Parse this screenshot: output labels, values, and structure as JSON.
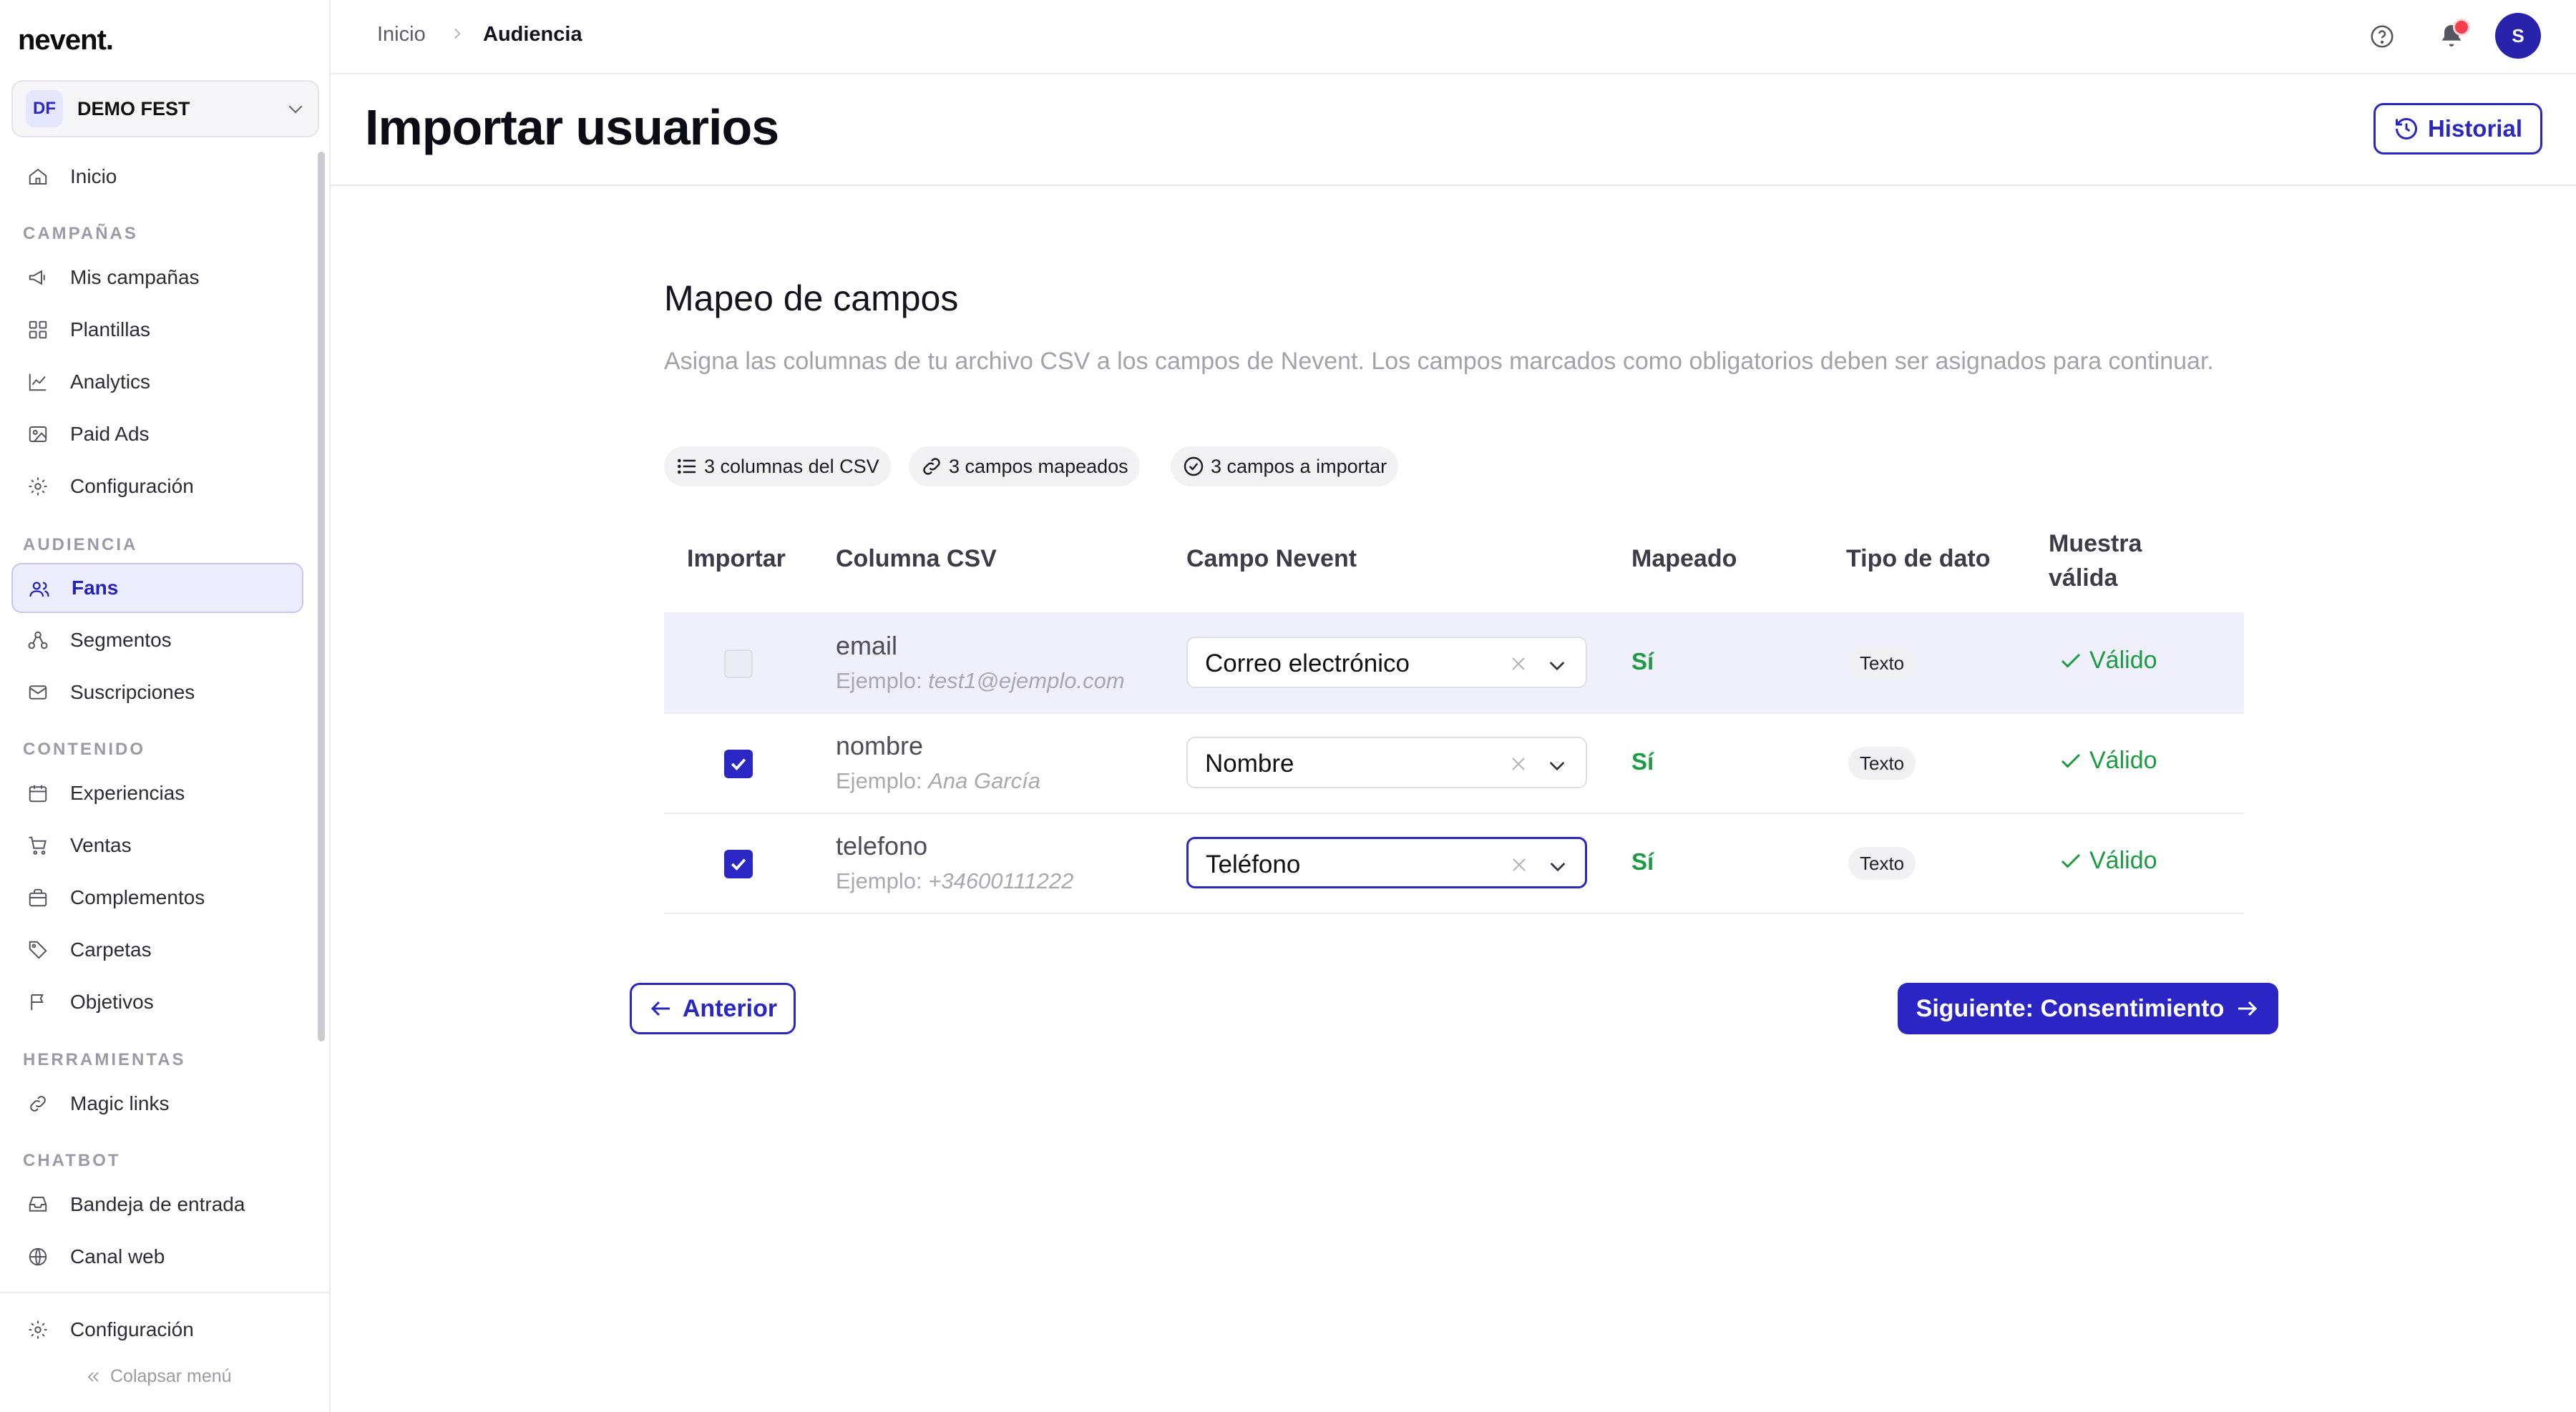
{
  "app": {
    "logo": "nevent."
  },
  "org": {
    "initials": "DF",
    "name": "DEMO FEST"
  },
  "sidebar": {
    "home": "Inicio",
    "campaigns_title": "CAMPAÑAS",
    "campaigns": [
      "Mis campañas",
      "Plantillas",
      "Analytics",
      "Paid Ads",
      "Configuración"
    ],
    "audience_title": "AUDIENCIA",
    "audience": [
      "Fans",
      "Segmentos",
      "Suscripciones"
    ],
    "content_title": "CONTENIDO",
    "content": [
      "Experiencias",
      "Ventas",
      "Complementos",
      "Carpetas",
      "Objetivos"
    ],
    "tools_title": "HERRAMIENTAS",
    "tools": [
      "Magic links"
    ],
    "chatbot_title": "CHATBOT",
    "chatbot": [
      "Bandeja de entrada",
      "Canal web"
    ],
    "settings": "Configuración",
    "collapse": "Colapsar menú"
  },
  "breadcrumb": {
    "root": "Inicio",
    "current": "Audiencia"
  },
  "user": {
    "initial": "S"
  },
  "page": {
    "title": "Importar usuarios",
    "history_button": "Historial"
  },
  "mapping": {
    "title": "Mapeo de campos",
    "description": "Asigna las columnas de tu archivo CSV a los campos de Nevent. Los campos marcados como obligatorios deben ser asignados para continuar.",
    "chips": [
      "3 columnas del CSV",
      "3 campos mapeados",
      "3 campos a importar"
    ],
    "headers": {
      "import": "Importar",
      "csv_column": "Columna CSV",
      "nevent_field": "Campo Nevent",
      "mapped": "Mapeado",
      "data_type": "Tipo de dato",
      "sample": "Muestra válida"
    },
    "rows": [
      {
        "column": "email",
        "example_prefix": "Ejemplo:",
        "example": "test1@ejemplo.com",
        "field": "Correo electrónico",
        "mapped": "Sí",
        "type": "Texto",
        "valid": "Válido",
        "checked": true,
        "disabled": true
      },
      {
        "column": "nombre",
        "example_prefix": "Ejemplo:",
        "example": "Ana García",
        "field": "Nombre",
        "mapped": "Sí",
        "type": "Texto",
        "valid": "Válido",
        "checked": true,
        "disabled": false
      },
      {
        "column": "telefono",
        "example_prefix": "Ejemplo:",
        "example": "+34600111222",
        "field": "Teléfono",
        "mapped": "Sí",
        "type": "Texto",
        "valid": "Válido",
        "checked": true,
        "disabled": false
      }
    ]
  },
  "actions": {
    "previous": "Anterior",
    "next": "Siguiente: Consentimiento"
  },
  "colors": {
    "accent": "#2a26c0",
    "success": "#1d9a44",
    "notification": "#f33f4b"
  }
}
